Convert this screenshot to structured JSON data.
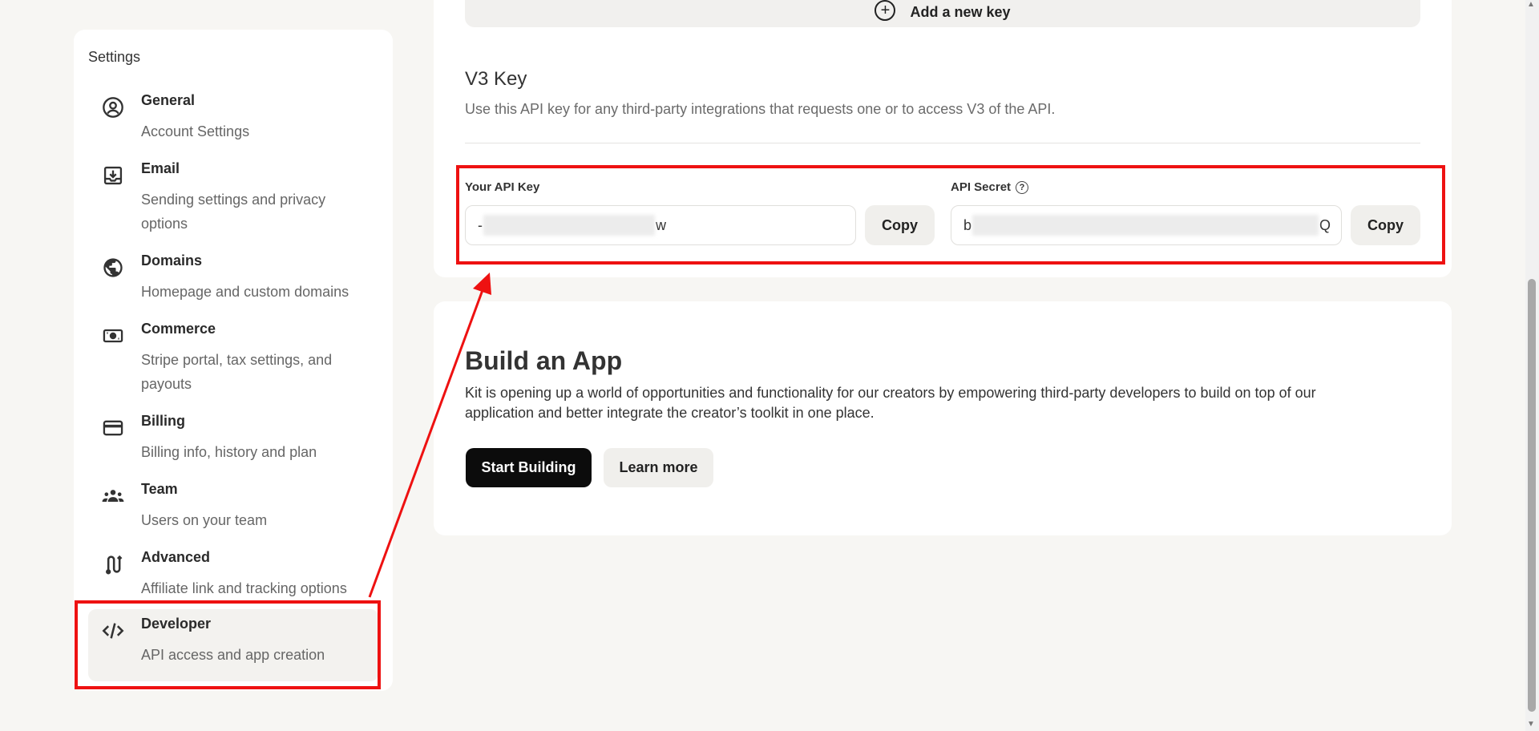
{
  "sidebar": {
    "title": "Settings",
    "items": [
      {
        "label": "General",
        "desc": "Account Settings",
        "icon": "account-circle-icon"
      },
      {
        "label": "Email",
        "desc": "Sending settings and privacy options",
        "icon": "inbox-download-icon"
      },
      {
        "label": "Domains",
        "desc": "Homepage and custom domains",
        "icon": "globe-icon"
      },
      {
        "label": "Commerce",
        "desc": "Stripe portal, tax settings, and payouts",
        "icon": "money-icon"
      },
      {
        "label": "Billing",
        "desc": "Billing info, history and plan",
        "icon": "credit-card-icon"
      },
      {
        "label": "Team",
        "desc": "Users on your team",
        "icon": "team-icon"
      },
      {
        "label": "Advanced",
        "desc": "Affiliate link and tracking options",
        "icon": "route-icon"
      },
      {
        "label": "Developer",
        "desc": "API access and app creation",
        "icon": "code-icon"
      }
    ]
  },
  "keys": {
    "add_key_label": "Add a new key",
    "v3_title": "V3 Key",
    "v3_desc": "Use this API key for any third-party integrations that requests one or to access V3 of the API.",
    "api_key_label": "Your API Key",
    "api_key_prefix": "-",
    "api_key_suffix": "w",
    "api_secret_label": "API Secret",
    "api_secret_help": "?",
    "api_secret_prefix": "b",
    "api_secret_suffix": "Q",
    "copy_label": "Copy"
  },
  "build_app": {
    "title": "Build an App",
    "desc": "Kit is opening up a world of opportunities and functionality for our creators by empowering third-party developers to build on top of our application and better integrate the creator’s toolkit in one place.",
    "start_label": "Start Building",
    "learn_label": "Learn more"
  },
  "colors": {
    "annotation": "#ee1111",
    "primary_button": "#0c0c0c",
    "background": "#f7f6f3"
  }
}
